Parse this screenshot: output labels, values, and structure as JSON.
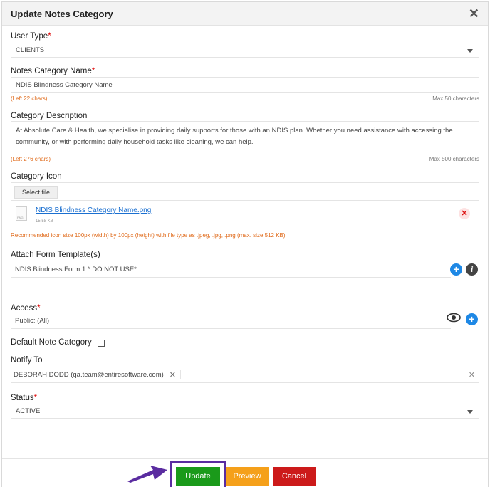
{
  "dialog": {
    "title": "Update Notes Category"
  },
  "user_type": {
    "label": "User Type",
    "required_mark": "*",
    "value": "CLIENTS"
  },
  "notes_category_name": {
    "label": "Notes Category Name",
    "required_mark": "*",
    "value": "NDIS Blindness Category Name",
    "left_chars": "(Left 22 chars)",
    "max_chars": "Max 50 characters"
  },
  "category_description": {
    "label": "Category Description",
    "value": "At Absolute Care & Health, we specialise in providing daily supports for those with an NDIS plan. Whether you need assistance with accessing the community, or with performing daily household tasks like cleaning, we can help.",
    "left_chars": "(Left 276 chars)",
    "max_chars": "Max 500 characters"
  },
  "category_icon": {
    "label": "Category Icon",
    "select_file_label": "Select file",
    "file_name": "NDIS Blindness Category Name.png",
    "file_size": "15.58 KB",
    "file_type_badge": "PNG",
    "recommendation": "Recommended icon size 100px (width) by 100px (height) with file type as .jpeg, .jpg, .png (max. size 512 KB)."
  },
  "form_template": {
    "label": "Attach Form Template(s)",
    "value": "NDIS Blindness Form 1 * DO NOT USE*"
  },
  "access": {
    "label": "Access",
    "required_mark": "*",
    "value": "Public: (All)"
  },
  "default_note_category": {
    "label": "Default Note Category",
    "checked": false
  },
  "notify_to": {
    "label": "Notify To",
    "tag": "DEBORAH DODD (qa.team@entiresoftware.com)"
  },
  "status": {
    "label": "Status",
    "required_mark": "*",
    "value": "ACTIVE"
  },
  "footer": {
    "update_label": "Update",
    "preview_label": "Preview",
    "cancel_label": "Cancel"
  },
  "colors": {
    "update": "#1a9a1a",
    "preview": "#f5a01a",
    "cancel": "#cc1a1a",
    "required": "#dd0000",
    "hint": "#e06a1a",
    "accent_blue": "#1e88e5",
    "annotation": "#5a2ca0"
  },
  "icons": [
    "close-icon",
    "chevron-down-icon",
    "file-icon",
    "remove-icon",
    "add-icon",
    "info-icon",
    "eye-icon",
    "tag-remove-icon",
    "clear-icon",
    "arrow-annotation"
  ]
}
